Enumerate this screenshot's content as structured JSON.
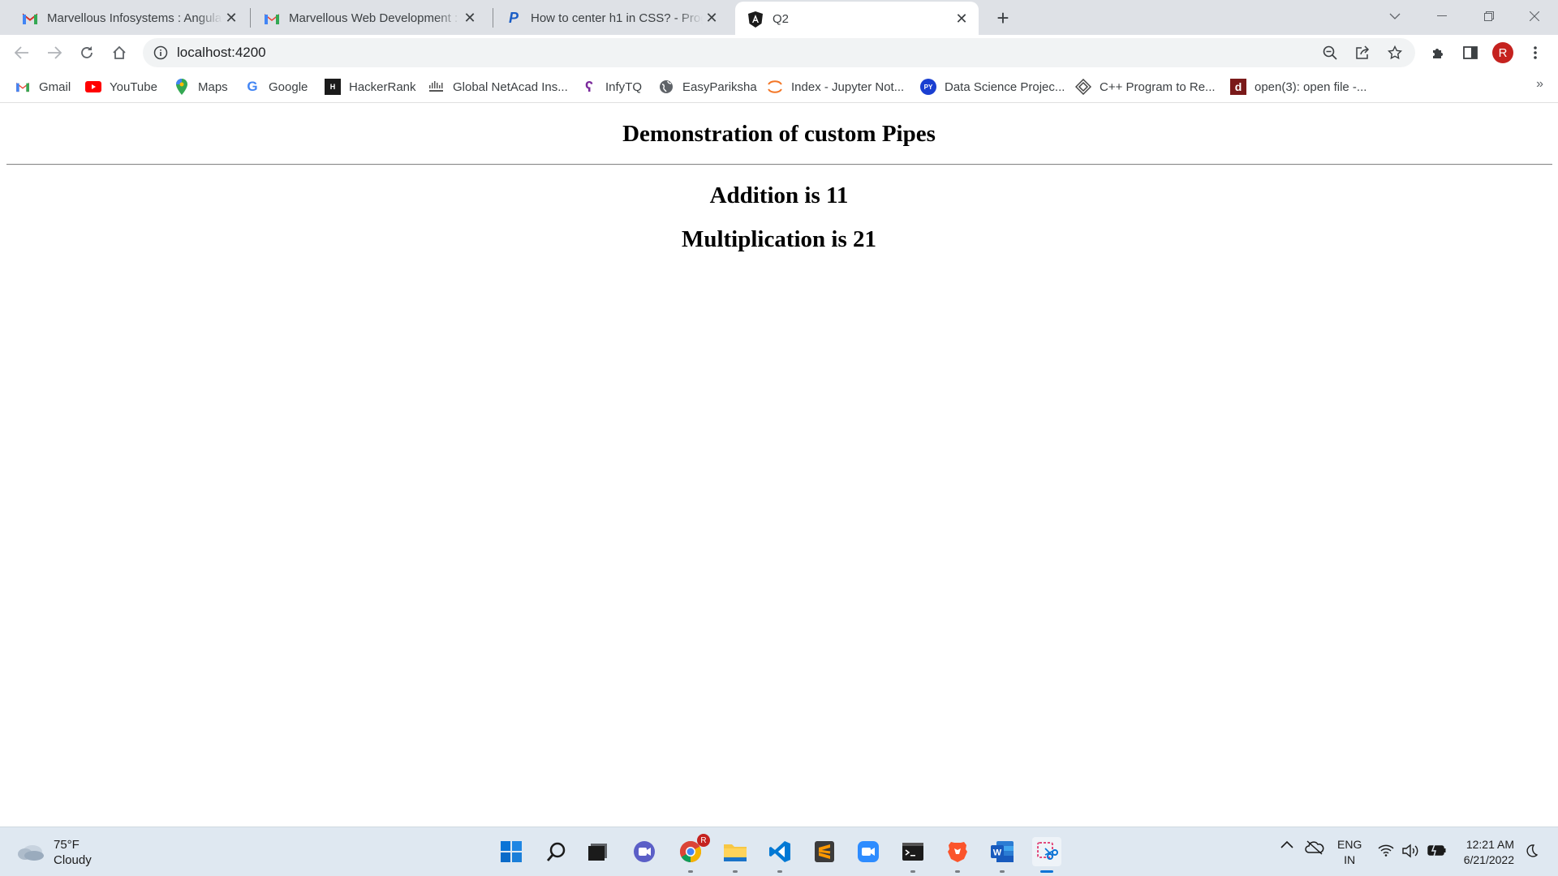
{
  "tabs": [
    {
      "title": "Marvellous Infosystems : Angular",
      "icon": "gmail-icon"
    },
    {
      "title": "Marvellous Web Development : A",
      "icon": "gmail-icon"
    },
    {
      "title": "How to center h1 in CSS? - Progr",
      "icon": "p-icon"
    },
    {
      "title": "Q2",
      "icon": "angular-icon",
      "active": true
    }
  ],
  "address_bar": {
    "url": "localhost:4200"
  },
  "bookmarks": [
    {
      "label": "Gmail"
    },
    {
      "label": "YouTube"
    },
    {
      "label": "Maps"
    },
    {
      "label": "Google"
    },
    {
      "label": "HackerRank"
    },
    {
      "label": "Global NetAcad Ins..."
    },
    {
      "label": "InfyTQ"
    },
    {
      "label": "EasyPariksha"
    },
    {
      "label": "Index - Jupyter Not..."
    },
    {
      "label": "Data Science Projec..."
    },
    {
      "label": "C++ Program to Re..."
    },
    {
      "label": "open(3): open file -..."
    }
  ],
  "profile": {
    "initial": "R"
  },
  "page": {
    "heading": "Demonstration of custom Pipes",
    "addition": "Addition is 11",
    "multiplication": "Multiplication is 21"
  },
  "taskbar": {
    "weather_temp": "75°F",
    "weather_desc": "Cloudy",
    "lang_line1": "ENG",
    "lang_line2": "IN",
    "time": "12:21 AM",
    "date": "6/21/2022",
    "chrome_badge": "R"
  },
  "colors": {
    "tab_strip": "#dee1e6",
    "taskbar": "#dfe8f1",
    "avatar": "#c5221f"
  }
}
